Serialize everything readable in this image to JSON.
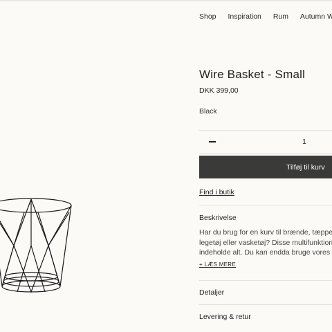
{
  "nav": {
    "items": [
      {
        "label": "Shop"
      },
      {
        "label": "Inspiration"
      },
      {
        "label": "Rum"
      },
      {
        "label": "Autumn Winter"
      }
    ]
  },
  "product": {
    "title": "Wire Basket - Small",
    "price": "DKK 399,00",
    "color": "Black",
    "quantity": "1",
    "add_to_cart_label": "Tilføj til kurv",
    "find_in_store_label": "Find i butik"
  },
  "description": {
    "heading": "Beskrivelse",
    "lines": [
      "Har du brug for en kurv til brænde, tæpper, puder",
      "legetøj eller vasketøj? Disse multifunktionelle kurve",
      "indeholde alt. Du kan endda bruge vores wire basket"
    ],
    "read_more_label": "+ LÆS MERE"
  },
  "accordion": {
    "details_label": "Detaljer",
    "shipping_label": "Levering & retur"
  },
  "colors": {
    "button_bg": "#3a3a38",
    "background": "#fbfaf6"
  }
}
